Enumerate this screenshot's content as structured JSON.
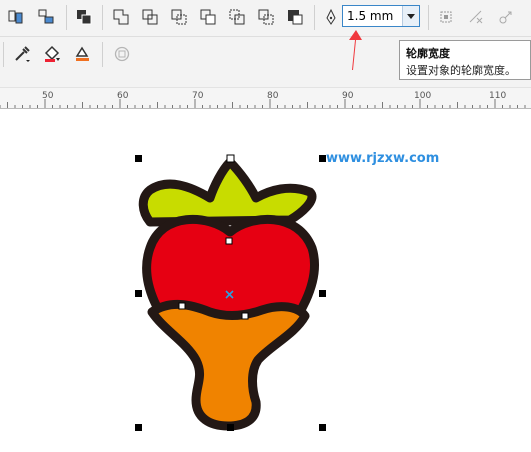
{
  "toolbar_property": {
    "outline_width": {
      "value": "1.5 mm",
      "dropdown_icon": "triangle-down-icon"
    },
    "buttons": [
      "combine-icon",
      "break-apart-icon",
      "group-icon",
      "weld-icon",
      "trim-icon",
      "intersect-icon",
      "simplify-icon",
      "front-minus-back-icon",
      "back-minus-front-icon",
      "create-boundary-icon",
      "pen-nib-icon",
      "convert-to-curves-icon",
      "dimension-icon",
      "link-icon"
    ],
    "row2": [
      "eyedropper-icon",
      "fill-icon",
      "outline-color-icon",
      "lock-icon"
    ]
  },
  "tooltip": {
    "title": "轮廓宽度",
    "description": "设置对象的轮廓宽度。"
  },
  "ruler": {
    "labels": [
      "50",
      "60",
      "70",
      "80",
      "90",
      "100",
      "110"
    ]
  },
  "watermark": "www.rjzxw.com",
  "colors": {
    "accent": "#3a86c8",
    "leaf": "#c8dc00",
    "berry": "#e60012",
    "drip": "#f08300",
    "outline": "#231815",
    "arrow": "#f0383d"
  }
}
